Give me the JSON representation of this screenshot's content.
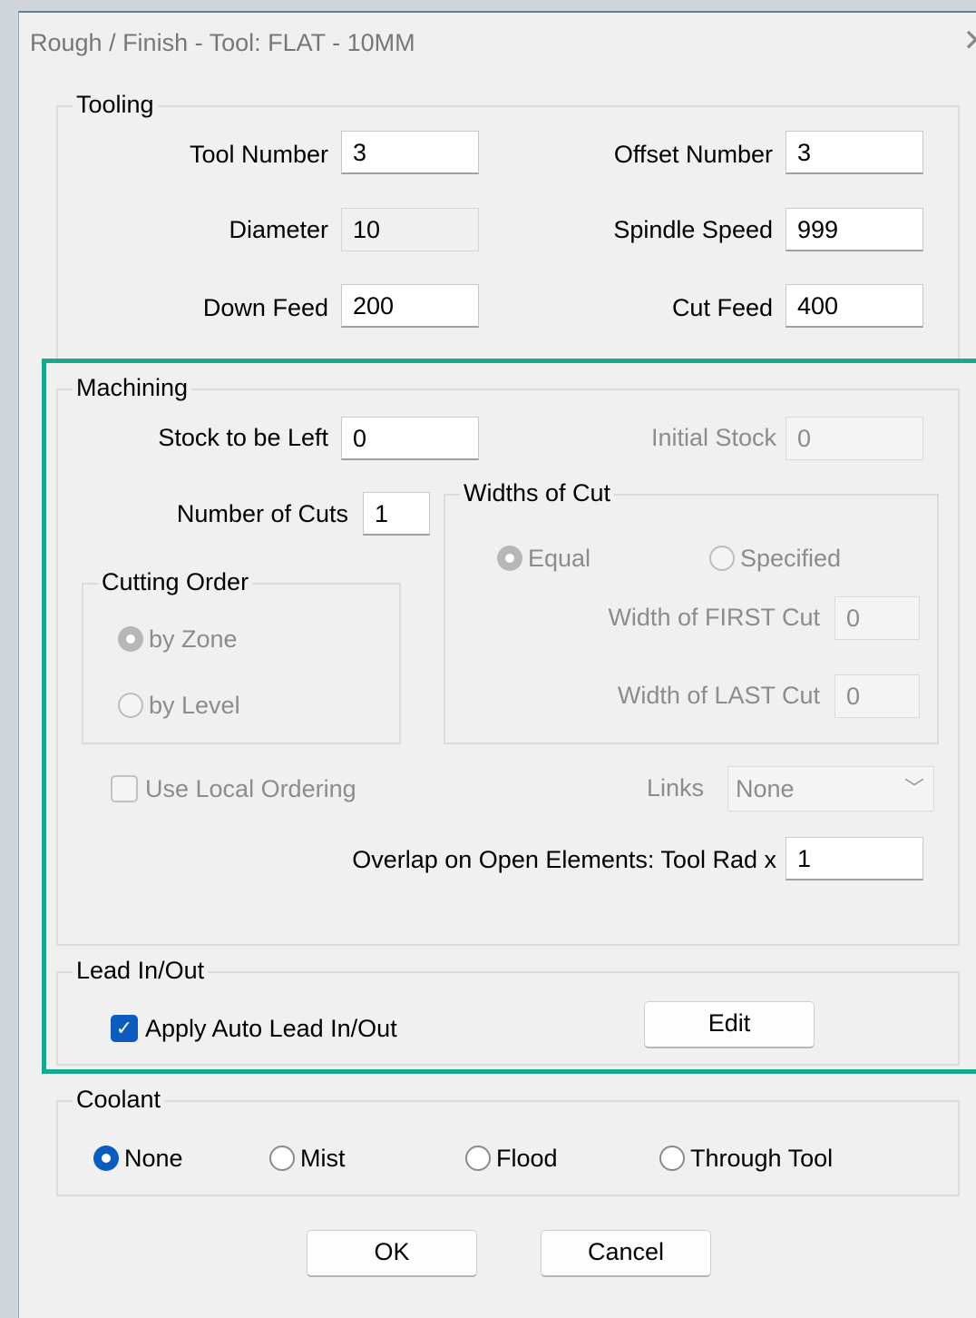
{
  "window": {
    "title": "Rough / Finish - Tool: FLAT - 10MM"
  },
  "tooling": {
    "group_label": "Tooling",
    "tool_number_label": "Tool Number",
    "tool_number": "3",
    "offset_number_label": "Offset Number",
    "offset_number": "3",
    "diameter_label": "Diameter",
    "diameter": "10",
    "spindle_speed_label": "Spindle Speed",
    "spindle_speed": "999",
    "down_feed_label": "Down Feed",
    "down_feed": "200",
    "cut_feed_label": "Cut Feed",
    "cut_feed": "400"
  },
  "machining": {
    "group_label": "Machining",
    "stock_left_label": "Stock to be Left",
    "stock_left": "0",
    "initial_stock_label": "Initial Stock",
    "initial_stock": "0",
    "num_cuts_label": "Number of Cuts",
    "num_cuts": "1",
    "cutting_order": {
      "label": "Cutting Order",
      "by_zone": "by Zone",
      "by_level": "by Level",
      "selected": "by Zone"
    },
    "widths": {
      "label": "Widths of Cut",
      "equal": "Equal",
      "specified": "Specified",
      "selected": "Equal",
      "first_label": "Width of FIRST Cut",
      "first": "0",
      "last_label": "Width of LAST Cut",
      "last": "0"
    },
    "use_local_ordering": "Use Local Ordering",
    "use_local_ordering_checked": false,
    "links_label": "Links",
    "links_value": "None",
    "overlap_label": "Overlap on Open Elements: Tool Rad x",
    "overlap": "1"
  },
  "lead": {
    "group_label": "Lead In/Out",
    "apply_label": "Apply Auto Lead In/Out",
    "apply_checked": true,
    "edit_label": "Edit"
  },
  "coolant": {
    "group_label": "Coolant",
    "options": [
      "None",
      "Mist",
      "Flood",
      "Through Tool"
    ],
    "selected": "None"
  },
  "buttons": {
    "ok": "OK",
    "cancel": "Cancel"
  },
  "colors": {
    "accent": "#0c5cbf",
    "highlight": "#17a98c"
  }
}
